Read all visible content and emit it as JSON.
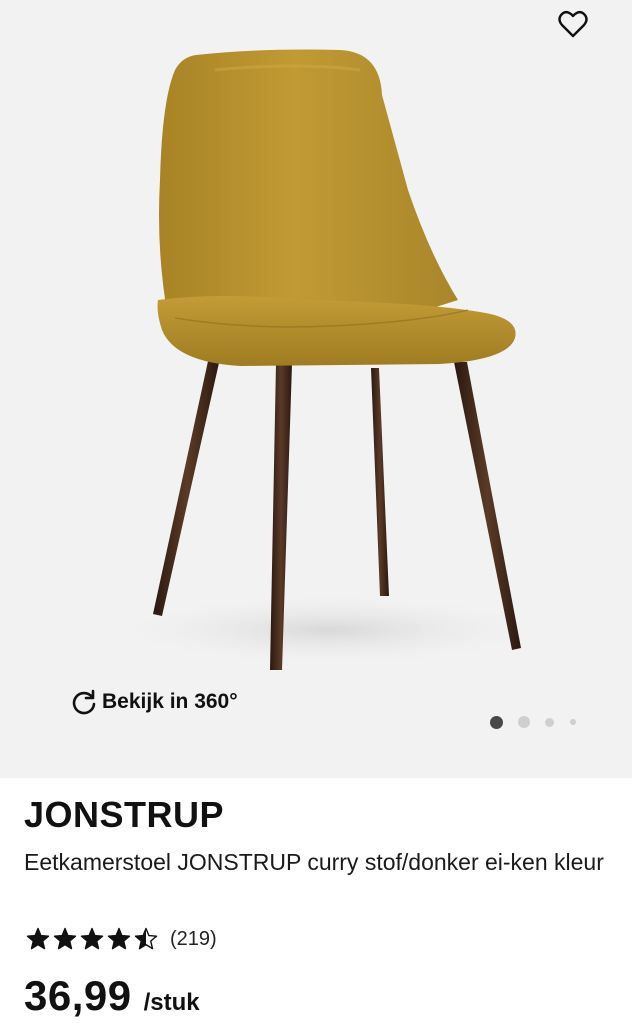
{
  "gallery": {
    "image_alt": "Eetkamerstoel JONSTRUP curry stof/donker eiken kleur",
    "view360_label": "Bekijk in 360°",
    "icons": {
      "wishlist": "heart-outline-icon",
      "view360": "rotate-icon"
    },
    "slides_total": 4,
    "active_slide": 1
  },
  "product": {
    "brand": "JONSTRUP",
    "description": "Eetkamerstoel JONSTRUP curry stof/donker ei-ken kleur",
    "rating": {
      "value": 4.5,
      "max": 5,
      "review_count": "(219)"
    },
    "price": "36,99",
    "unit": "/stuk"
  },
  "colors": {
    "gallery_background": "#f2f2f2",
    "seat_fabric": "#b8922e",
    "legs": "#3a2418",
    "text": "#111111"
  }
}
